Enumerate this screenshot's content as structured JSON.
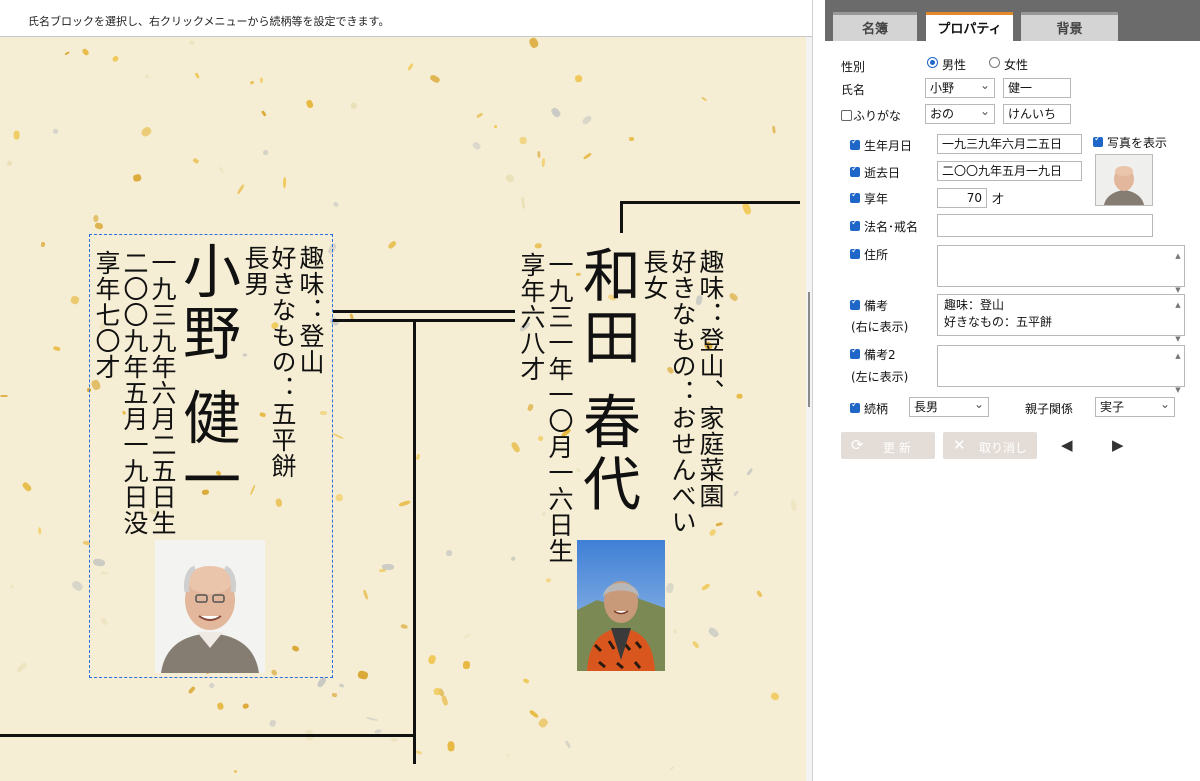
{
  "hint_text": "氏名ブロックを選択し、右クリックメニューから続柄等を設定できます。",
  "tabs": [
    {
      "label": "名簿",
      "active": false
    },
    {
      "label": "プロパティ",
      "active": true
    },
    {
      "label": "背景",
      "active": false
    }
  ],
  "chart": {
    "person1": {
      "name": "小野 健一",
      "relation": "長男",
      "note_line1": "趣味：登山",
      "note_line2": "好きなもの：五平餅",
      "birth": "一九三九年六月二五日生",
      "death": "二〇〇九年五月一九日没",
      "age": "享年七〇才"
    },
    "person2": {
      "name": "和田 春代",
      "relation": "長女",
      "note_line1": "趣味：登山、家庭菜園",
      "note_line2": "好きなもの：おせんべい",
      "birth": "一九三一年一〇月一六日生",
      "age": "享年六八才"
    }
  },
  "props": {
    "gender_label": "性別",
    "gender_male": "男性",
    "gender_female": "女性",
    "gender_selected": "男性",
    "name_label": "氏名",
    "surname": "小野",
    "given_name": "健一",
    "furigana_label": "ふりがな",
    "furigana_checked": false,
    "surname_kana": "おの",
    "given_kana": "けんいち",
    "birth_label": "生年月日",
    "birth_value": "一九三九年六月二五日",
    "death_label": "逝去日",
    "death_value": "二〇〇九年五月一九日",
    "age_label": "享年",
    "age_value": "70",
    "age_unit": "才",
    "photo_label": "写真を表示",
    "dharma_label": "法名･戒名",
    "dharma_value": "",
    "address_label": "住所",
    "address_value": "",
    "note_label": "備考",
    "note_sub": "(右に表示)",
    "note_line1": "趣味：登山",
    "note_line2": "好きなもの：五平餅",
    "note2_label": "備考2",
    "note2_sub": "(左に表示)",
    "relation_label": "続柄",
    "relation_value": "長男",
    "parent_label": "親子関係",
    "parent_value": "実子",
    "update_button": "更 新",
    "cancel_button": "取り消し",
    "prev_icon": "left-triangle-icon",
    "next_icon": "right-triangle-icon"
  },
  "colors": {
    "accent_tab": "#e28a2b",
    "checkbox": "#1f66c9",
    "selection": "#2b6fe0",
    "paper": "#f6eed4"
  }
}
